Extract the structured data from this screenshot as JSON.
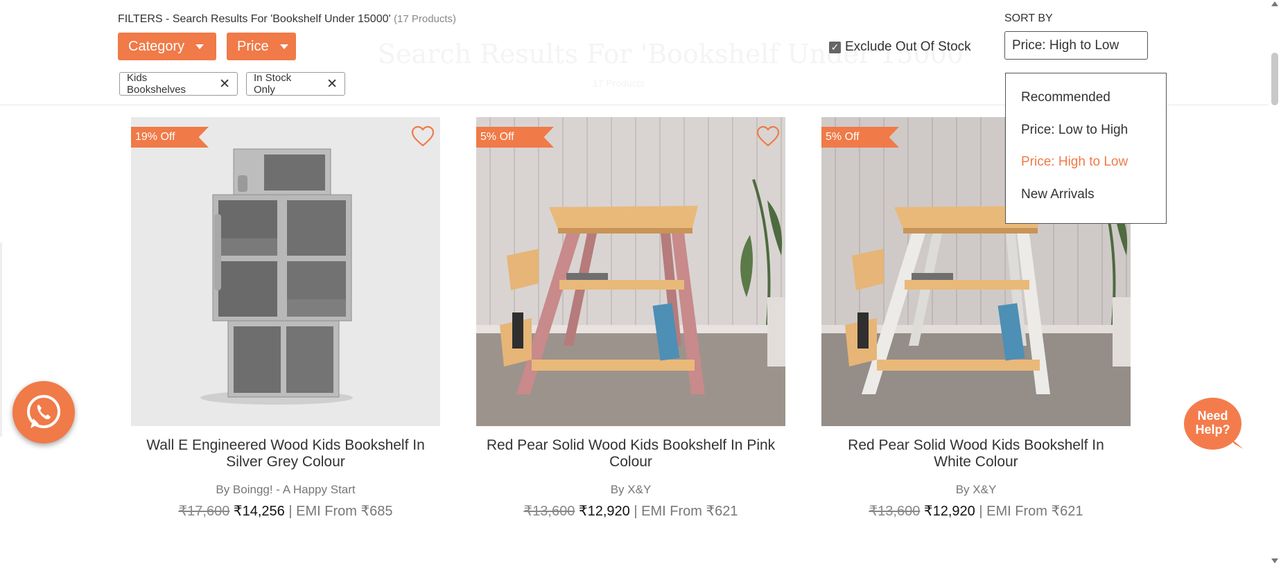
{
  "background_heading": {
    "title": "Search Results For 'Bookshelf Under 15000'",
    "subtitle": "17 Products"
  },
  "filters": {
    "prefix": "FILTERS - Search Results For 'Bookshelf Under 15000'",
    "count": "(17 Products)",
    "category_label": "Category",
    "price_label": "Price",
    "chips": [
      {
        "label": "Kids Bookshelves"
      },
      {
        "label": "In Stock Only"
      }
    ],
    "exclude_out_of_stock_label": "Exclude Out Of Stock",
    "exclude_out_of_stock_checked": true
  },
  "sort": {
    "label": "SORT BY",
    "selected": "Price: High to Low",
    "options": [
      {
        "label": "Recommended"
      },
      {
        "label": "Price: Low to High"
      },
      {
        "label": "Price: High to Low",
        "active": true
      },
      {
        "label": "New Arrivals"
      }
    ]
  },
  "products": [
    {
      "discount": "19% Off",
      "title": "Wall E Engineered Wood Kids Bookshelf In Silver Grey Colour",
      "brand": "By Boingg! - A Happy Start",
      "mrp": "₹17,600",
      "price": "₹14,256",
      "emi": "| EMI From ₹685",
      "image": "grey-robot-shaped-bookshelf"
    },
    {
      "discount": "5% Off",
      "title": "Red Pear Solid Wood Kids Bookshelf In Pink Colour",
      "brand": "By X&Y",
      "mrp": "₹13,600",
      "price": "₹12,920",
      "emi": "| EMI From ₹621",
      "image": "pink-a-frame-bookshelf"
    },
    {
      "discount": "5% Off",
      "title": "Red Pear Solid Wood Kids Bookshelf In White Colour",
      "brand": "By X&Y",
      "mrp": "₹13,600",
      "price": "₹12,920",
      "emi": "| EMI From ₹621",
      "image": "white-a-frame-bookshelf"
    }
  ],
  "help_button": {
    "line1": "Need",
    "line2": "Help?"
  },
  "icons": {
    "whatsapp": "whatsapp-icon",
    "wishlist": "heart-outline-icon",
    "remove_chip": "close-icon",
    "dropdown": "caret-down-icon"
  },
  "colors": {
    "accent": "#f07a48",
    "text": "#333333",
    "muted": "#777777"
  }
}
